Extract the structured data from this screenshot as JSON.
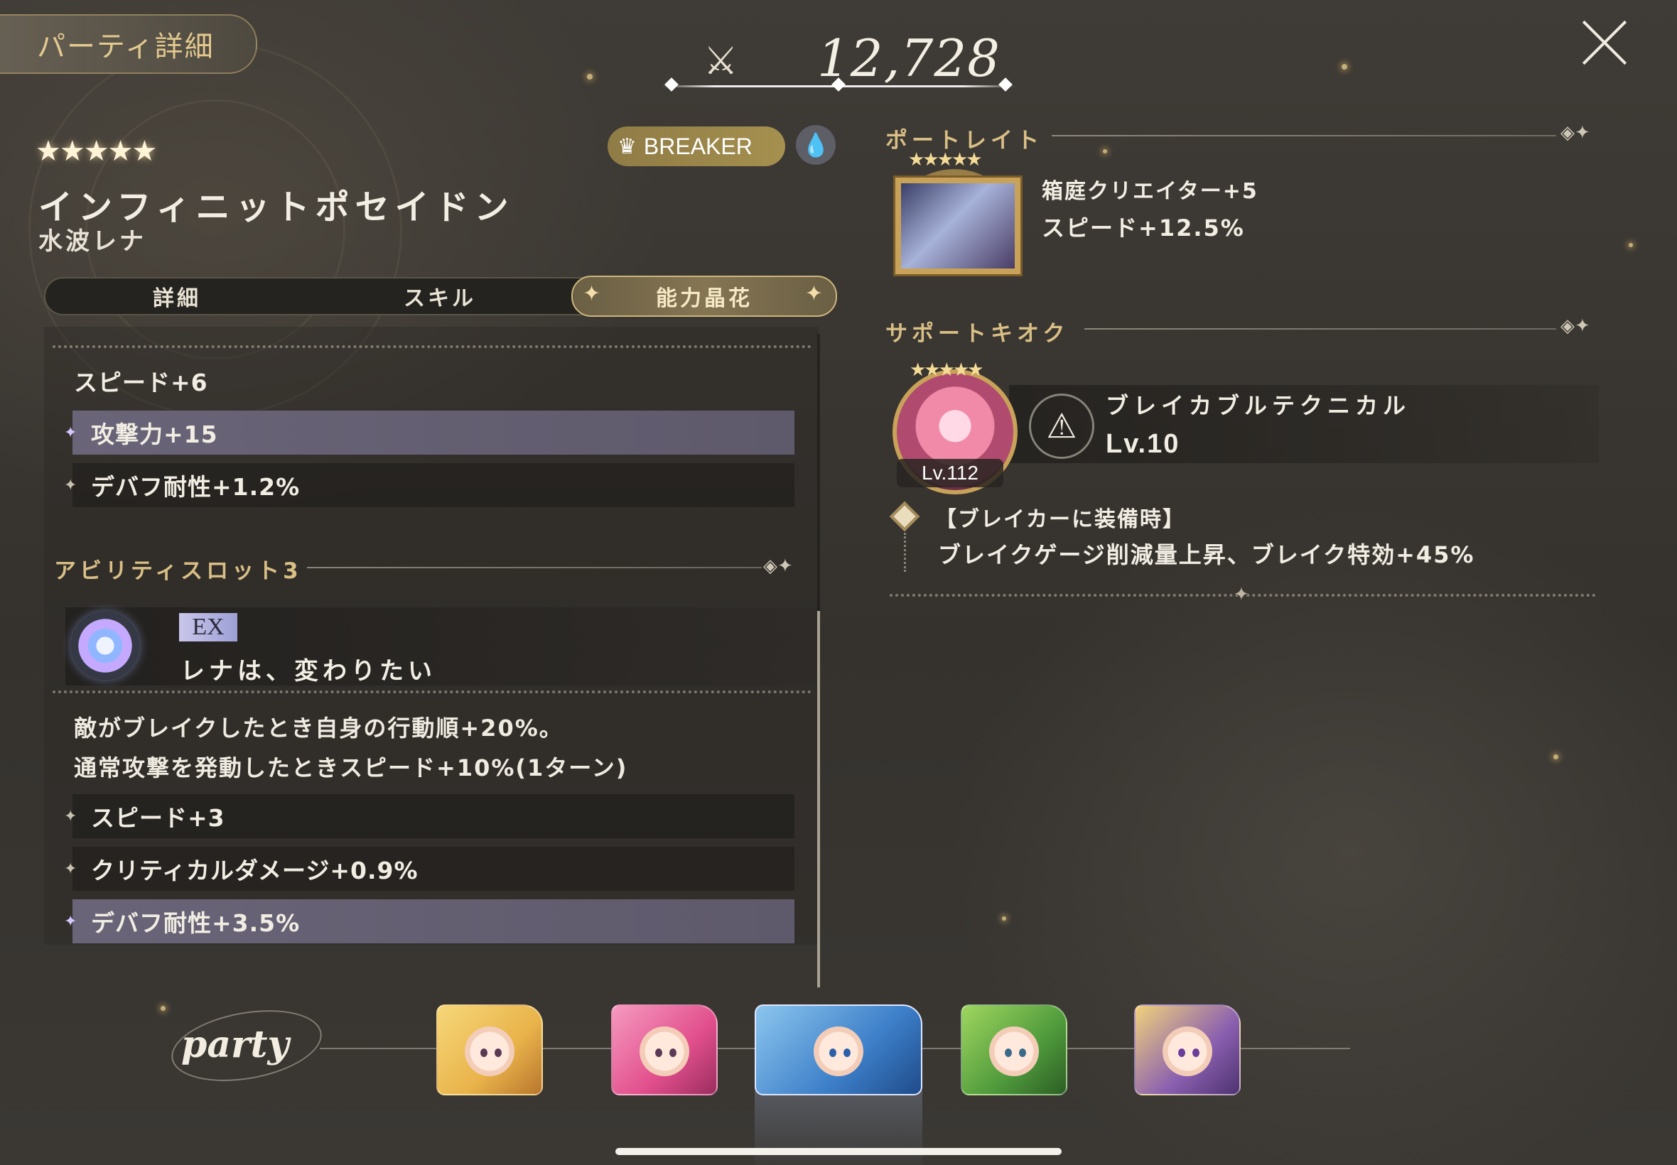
{
  "header": {
    "title": "パーティ詳細",
    "power_icon": "crossed-swords-icon",
    "power_value": "12,728",
    "close_icon": "close-x-icon"
  },
  "character": {
    "rarity_stars": "★★★★★",
    "name": "インフィニットポセイドン",
    "subname": "水波レナ",
    "role": "BREAKER",
    "role_icon": "breaker-claw-icon",
    "element_icon": "water-drop-icon"
  },
  "tabs": [
    {
      "label": "詳細",
      "active": false
    },
    {
      "label": "スキル",
      "active": false
    },
    {
      "label": "能力晶花",
      "active": true
    }
  ],
  "left": {
    "stats_top": [
      {
        "label": "スピード+6",
        "style": "plain"
      },
      {
        "label": "攻撃力+15",
        "style": "highlight"
      },
      {
        "label": "デバフ耐性+1.2%",
        "style": "dark"
      }
    ],
    "ability_slot": {
      "title": "アビリティスロット3",
      "tag": "EX",
      "name": "レナは、変わりたい",
      "desc_line1": "敵がブレイクしたとき自身の行動順+20%。",
      "desc_line2": "通常攻撃を発動したときスピード+10%(1ターン)",
      "stats": [
        {
          "label": "スピード+3",
          "style": "dark"
        },
        {
          "label": "クリティカルダメージ+0.9%",
          "style": "dark"
        },
        {
          "label": "デバフ耐性+3.5%",
          "style": "highlight"
        }
      ]
    }
  },
  "right": {
    "portrait": {
      "title": "ポートレイト",
      "line1": "箱庭クリエイター+5",
      "line2": "スピード+12.5%"
    },
    "support": {
      "title": "サポートキオク",
      "level": "Lv.112",
      "skill_name": "ブレイカブルテクニカル",
      "skill_level": "Lv.10",
      "skill_icon": "break-triangle-icon",
      "effect_condition": "【ブレイカーに装備時】",
      "effect_text": "ブレイクゲージ削減量上昇、ブレイク特効+45%"
    }
  },
  "party": {
    "label": "party",
    "members": [
      {
        "name": "member-1",
        "color": "#e9b34a",
        "hair": "#f6d779",
        "selected": false
      },
      {
        "name": "member-2",
        "color": "#e24f8c",
        "hair": "#f59ac0",
        "selected": false
      },
      {
        "name": "member-3",
        "color": "#3d7fc9",
        "hair": "#8cc6ee",
        "selected": true
      },
      {
        "name": "member-4",
        "color": "#4f9a3c",
        "hair": "#9fd65f",
        "selected": false
      },
      {
        "name": "member-5",
        "color": "#8a5fb0",
        "hair": "#f1d27a",
        "selected": false
      }
    ]
  }
}
